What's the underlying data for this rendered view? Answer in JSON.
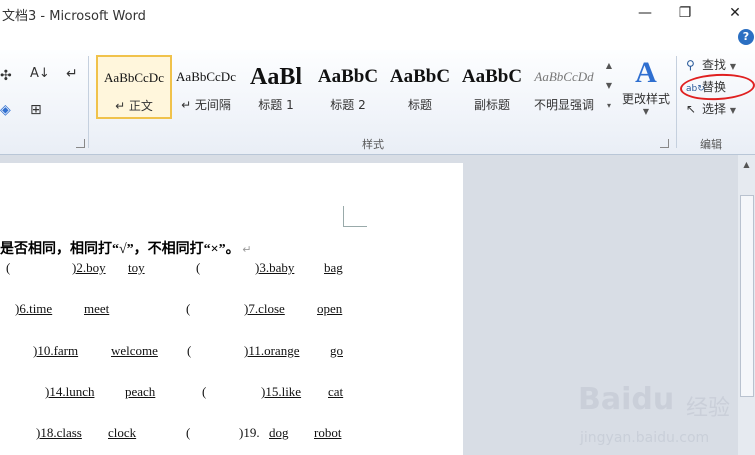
{
  "window": {
    "title": "文档3 - Microsoft Word",
    "minimize": "—",
    "restore": "❐",
    "close": "✕",
    "help": "?"
  },
  "ribbon": {
    "styles_group": {
      "label": "样式",
      "styles": [
        {
          "preview": "AaBbCcDc",
          "name": "↵ 正文",
          "selected": true
        },
        {
          "preview": "AaBbCcDc",
          "name": "↵ 无间隔"
        },
        {
          "preview": "AaBl",
          "name": "标题 1"
        },
        {
          "preview": "AaBbC",
          "name": "标题 2"
        },
        {
          "preview": "AaBbC",
          "name": "标题"
        },
        {
          "preview": "AaBbC",
          "name": "副标题"
        },
        {
          "preview": "AaBbCcDd",
          "name": "不明显强调"
        }
      ],
      "change_styles": "更改样式"
    },
    "editing_group": {
      "label": "编辑",
      "find": "查找",
      "replace": "替换",
      "select": "选择"
    }
  },
  "document": {
    "instruction": "是否相同，相同打“√”，不相同打“×”。",
    "rows": [
      [
        "(",
        ")2.boy",
        "toy",
        "(",
        ")3.baby",
        "bag"
      ],
      [
        ")6.time",
        "meet",
        "(",
        ")7.close",
        "open"
      ],
      [
        ")10.farm",
        "welcome",
        "(",
        ")11.orange",
        "go"
      ],
      [
        ")14.lunch",
        "peach",
        "(",
        ")15.like",
        "cat"
      ],
      [
        ")18.class",
        "clock",
        "(",
        ")19.",
        "dog",
        "robot"
      ]
    ]
  },
  "watermark": {
    "brand": "Baidu",
    "cn": "经验",
    "url": "jingyan.baidu.com"
  },
  "colors": {
    "annotation": "#e02020",
    "accent": "#2f6fd0",
    "selected_style": "#f0c24b"
  }
}
